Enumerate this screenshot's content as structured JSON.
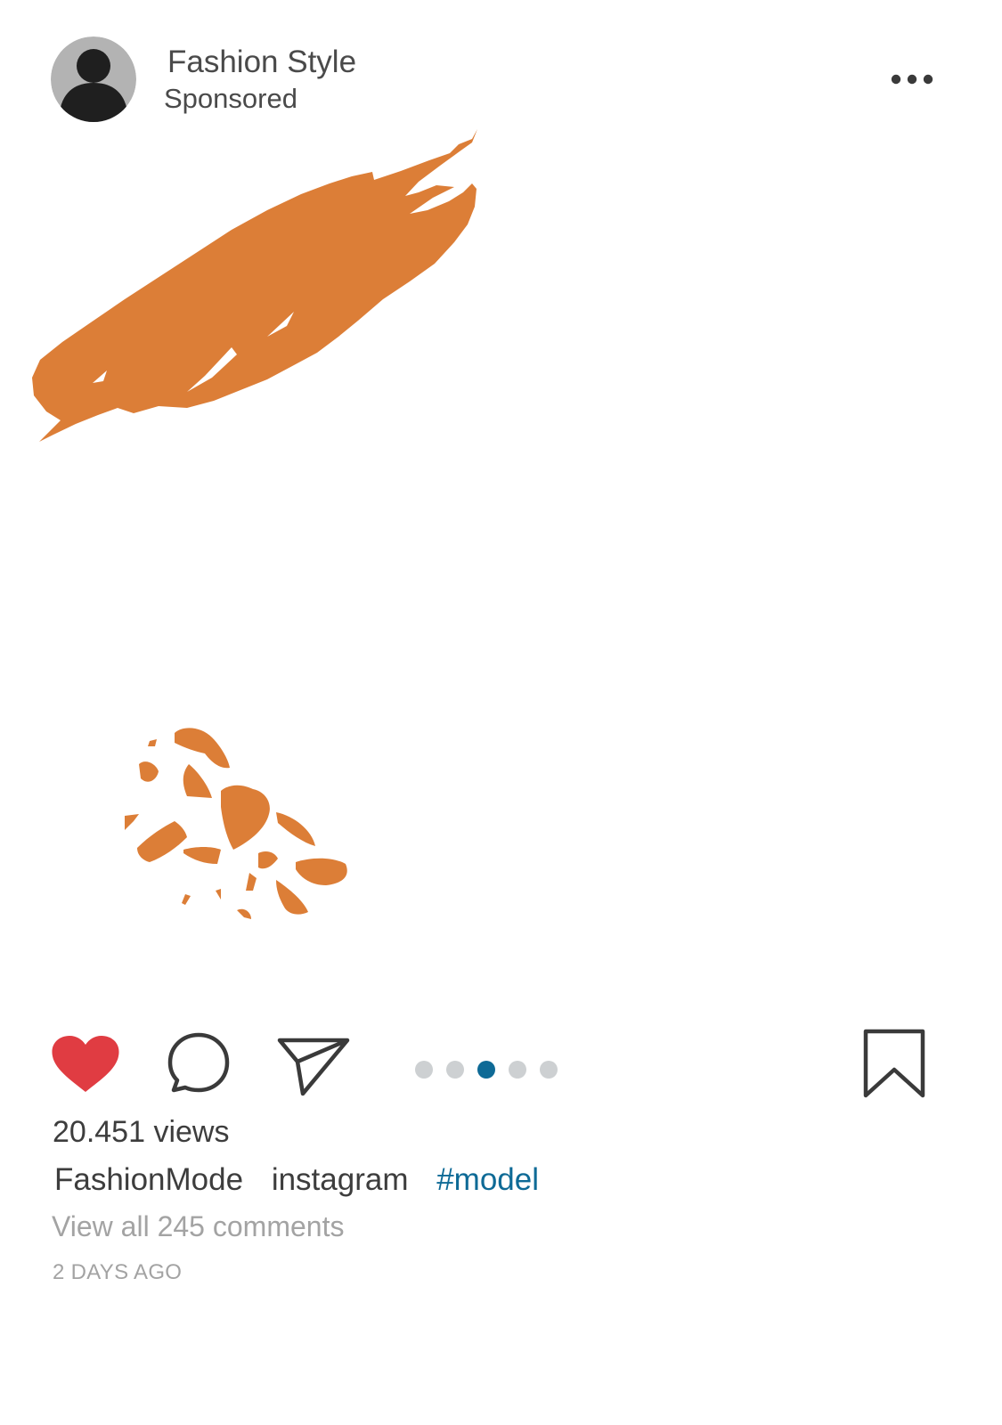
{
  "post": {
    "account_name": "Fashion Style",
    "account_subtitle": "Sponsored",
    "views": "20.451 views",
    "caption": {
      "username": "FashionMode",
      "text": "instagram",
      "hashtag": "#model"
    },
    "view_comments": "View all 245 comments",
    "timestamp": "2 DAYS AGO"
  },
  "carousel": {
    "total": 5,
    "active_index": 2
  },
  "icons": {
    "avatar": "person-avatar-icon",
    "more": "more-horizontal-icon",
    "like": "heart-icon",
    "comment": "comment-icon",
    "share": "paper-plane-icon",
    "save": "bookmark-icon"
  },
  "colors": {
    "accent_orange": "#dc7e37",
    "like_red": "#e03c42",
    "hashtag_blue": "#0e6a96",
    "active_dot": "#0e6a96",
    "inactive_dot": "#cdd0d2",
    "icon_stroke": "#3a3a3a",
    "muted_text": "#a3a3a3"
  }
}
